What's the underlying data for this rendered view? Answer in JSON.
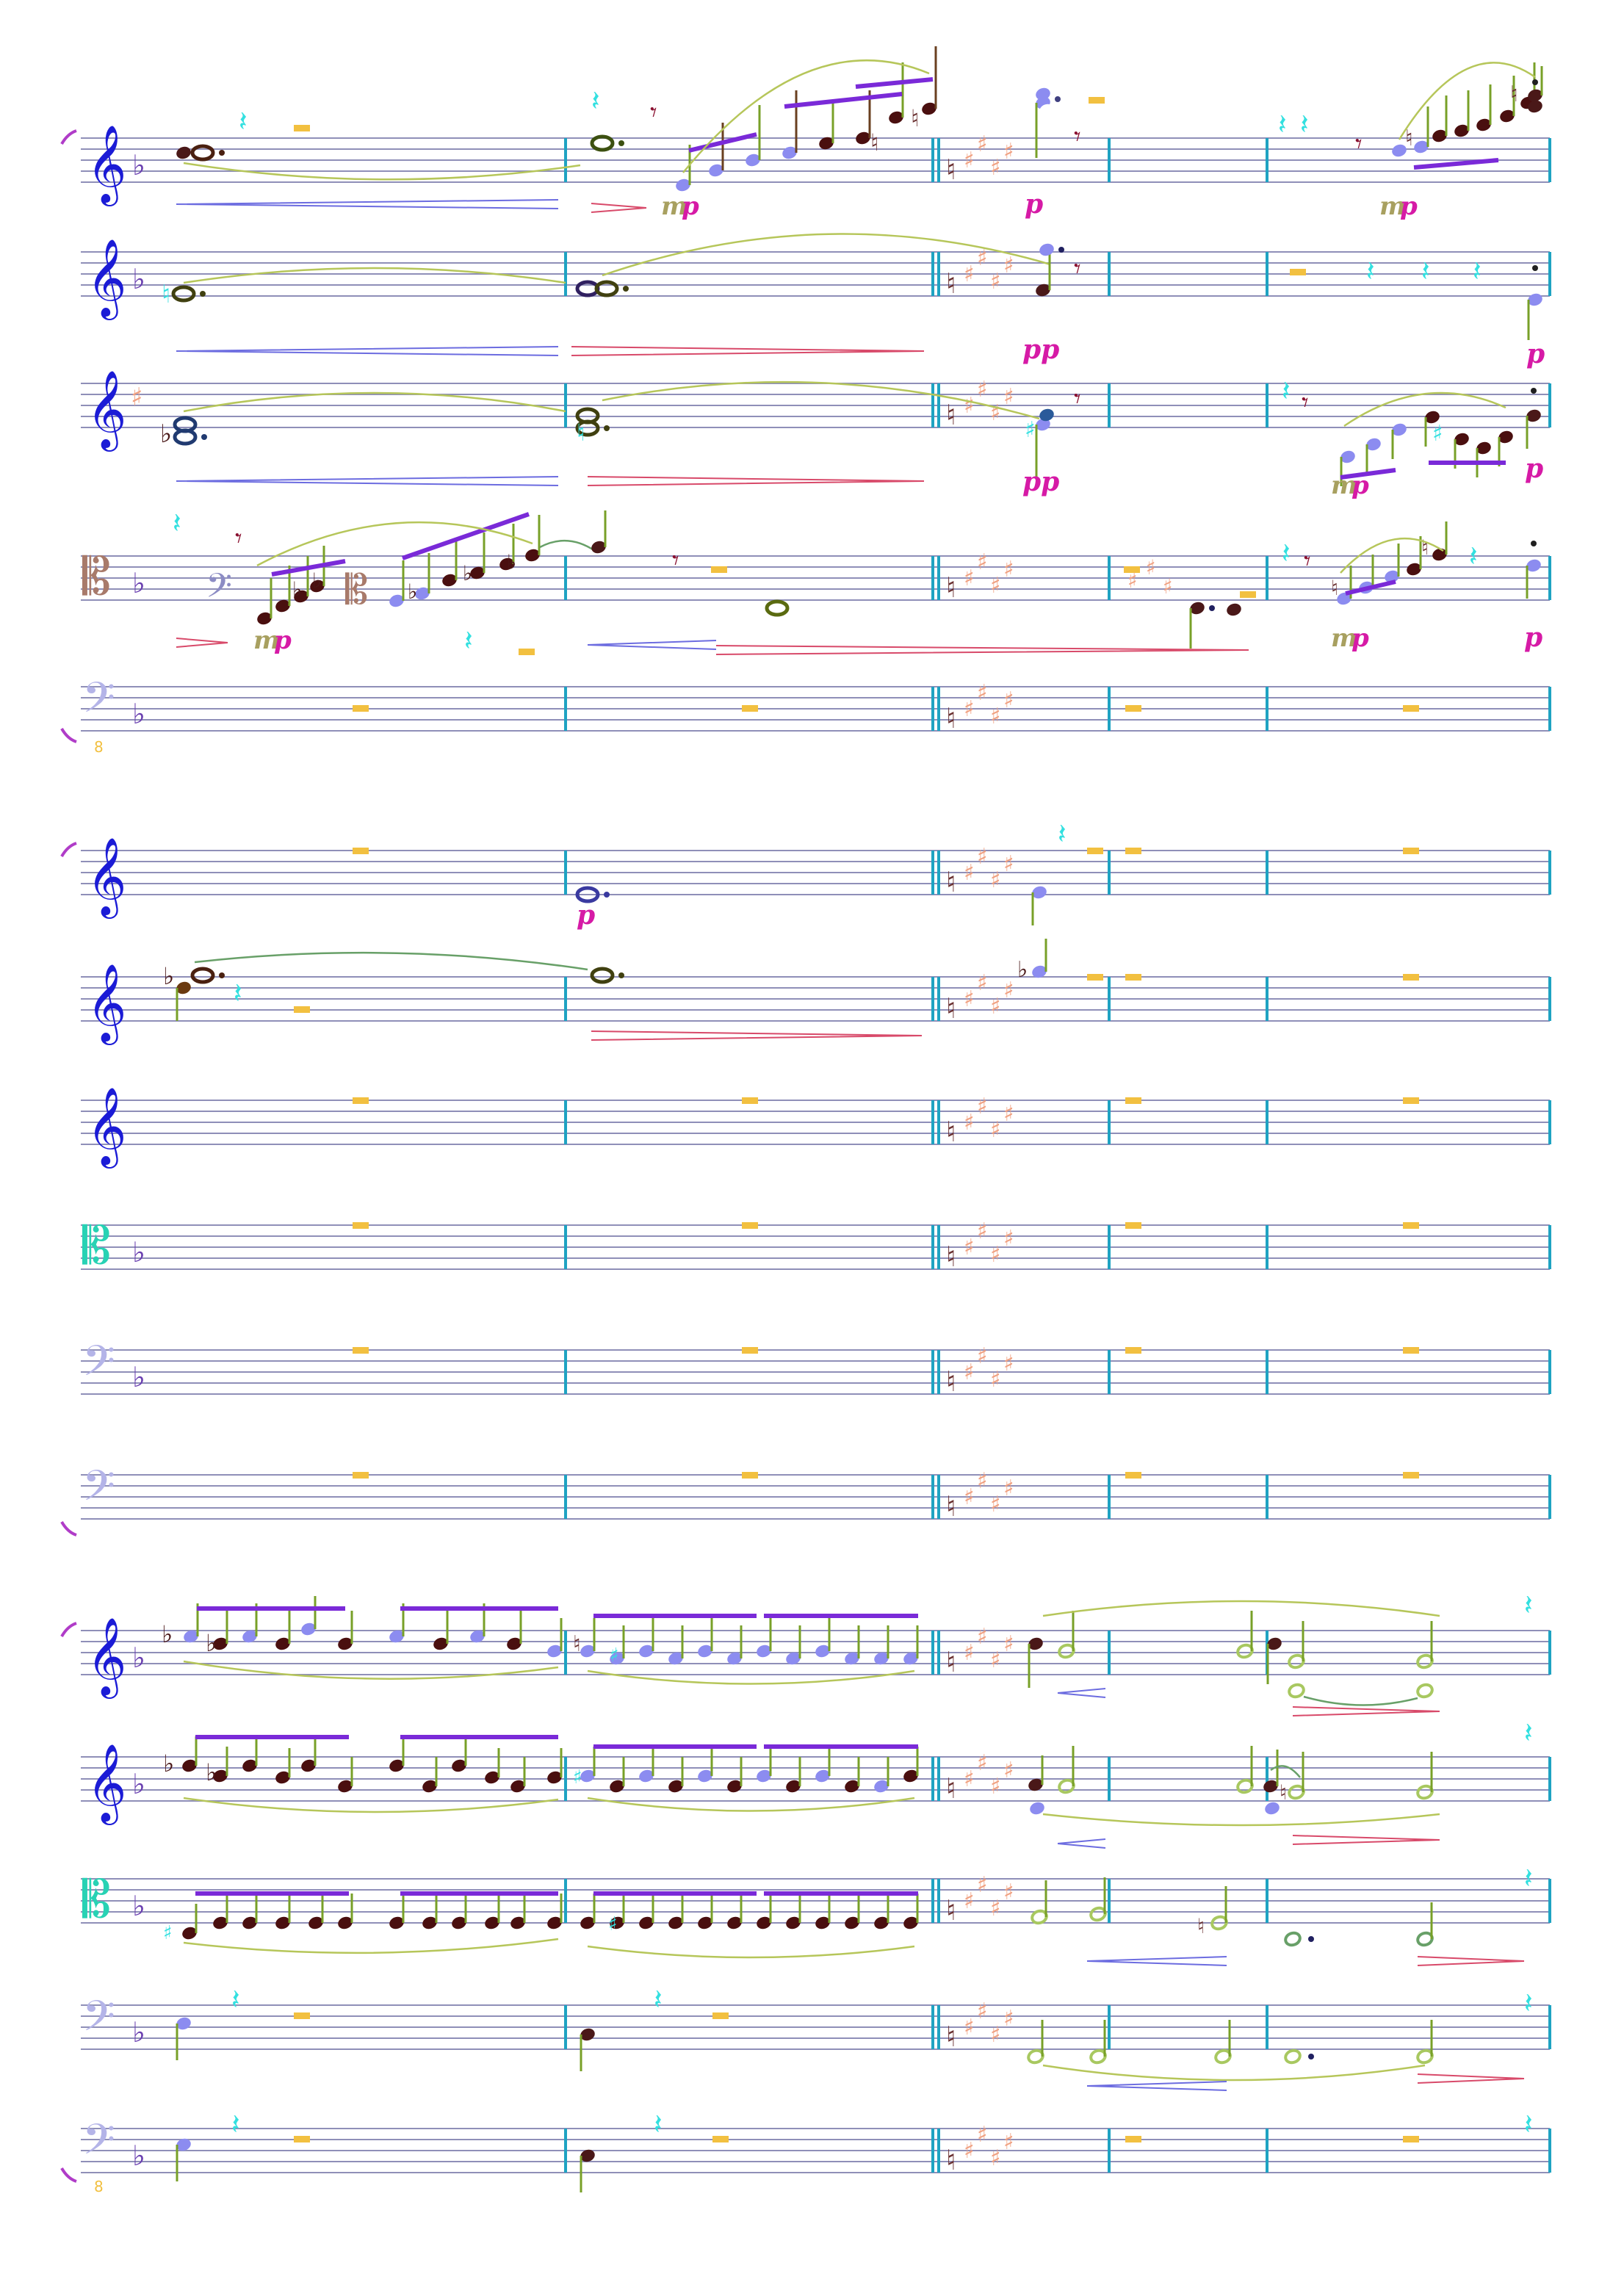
{
  "page": {
    "title": "",
    "background": "#ffffff"
  },
  "colors": {
    "staff_line": "#8f8fb8",
    "barline": "#1fa3c2",
    "slur": "#b6c65a",
    "dynamic_pink": "#d61aa6",
    "dynamic_olive": "#a8a060",
    "hairpin_blue": "#6c6ce0",
    "hairpin_red": "#d84a6a",
    "treble_clef": "#1b1bd6",
    "bass_clef": "#b4b4e8",
    "bass_clef_dark": "#8c8cc4",
    "alto_clef_teal": "#28d2b4",
    "alto_clef_brown": "#a87a6a",
    "sharp_key": "#f0a080",
    "rest_cyan": "#33e0e0",
    "whole_rest": "#f2c040",
    "beam": "#7a2ad8",
    "notehead_dark": "#4a0f0f",
    "notehead_light": "#8c8cf0",
    "stem": "#78a028"
  },
  "icons": {
    "treble": "treble-clef-icon",
    "bass": "bass-clef-icon",
    "alto": "alto-clef-icon",
    "rest": "quarter-rest-icon",
    "eighth_rest": "eighth-rest-icon",
    "whole_rest": "whole-rest-icon",
    "brace": "system-bracket-icon"
  },
  "glyphs": {
    "treble": "𝄞",
    "bass": "𝄢",
    "alto": "𝄡",
    "flat": "♭",
    "sharp": "♯",
    "natural": "♮",
    "quarter_rest": "𝄽",
    "eighth_rest": "𝄾",
    "ottava": "8"
  },
  "dynamics": {
    "p": "p",
    "pp": "pp",
    "mp_m": "m",
    "mp_p": "p"
  }
}
